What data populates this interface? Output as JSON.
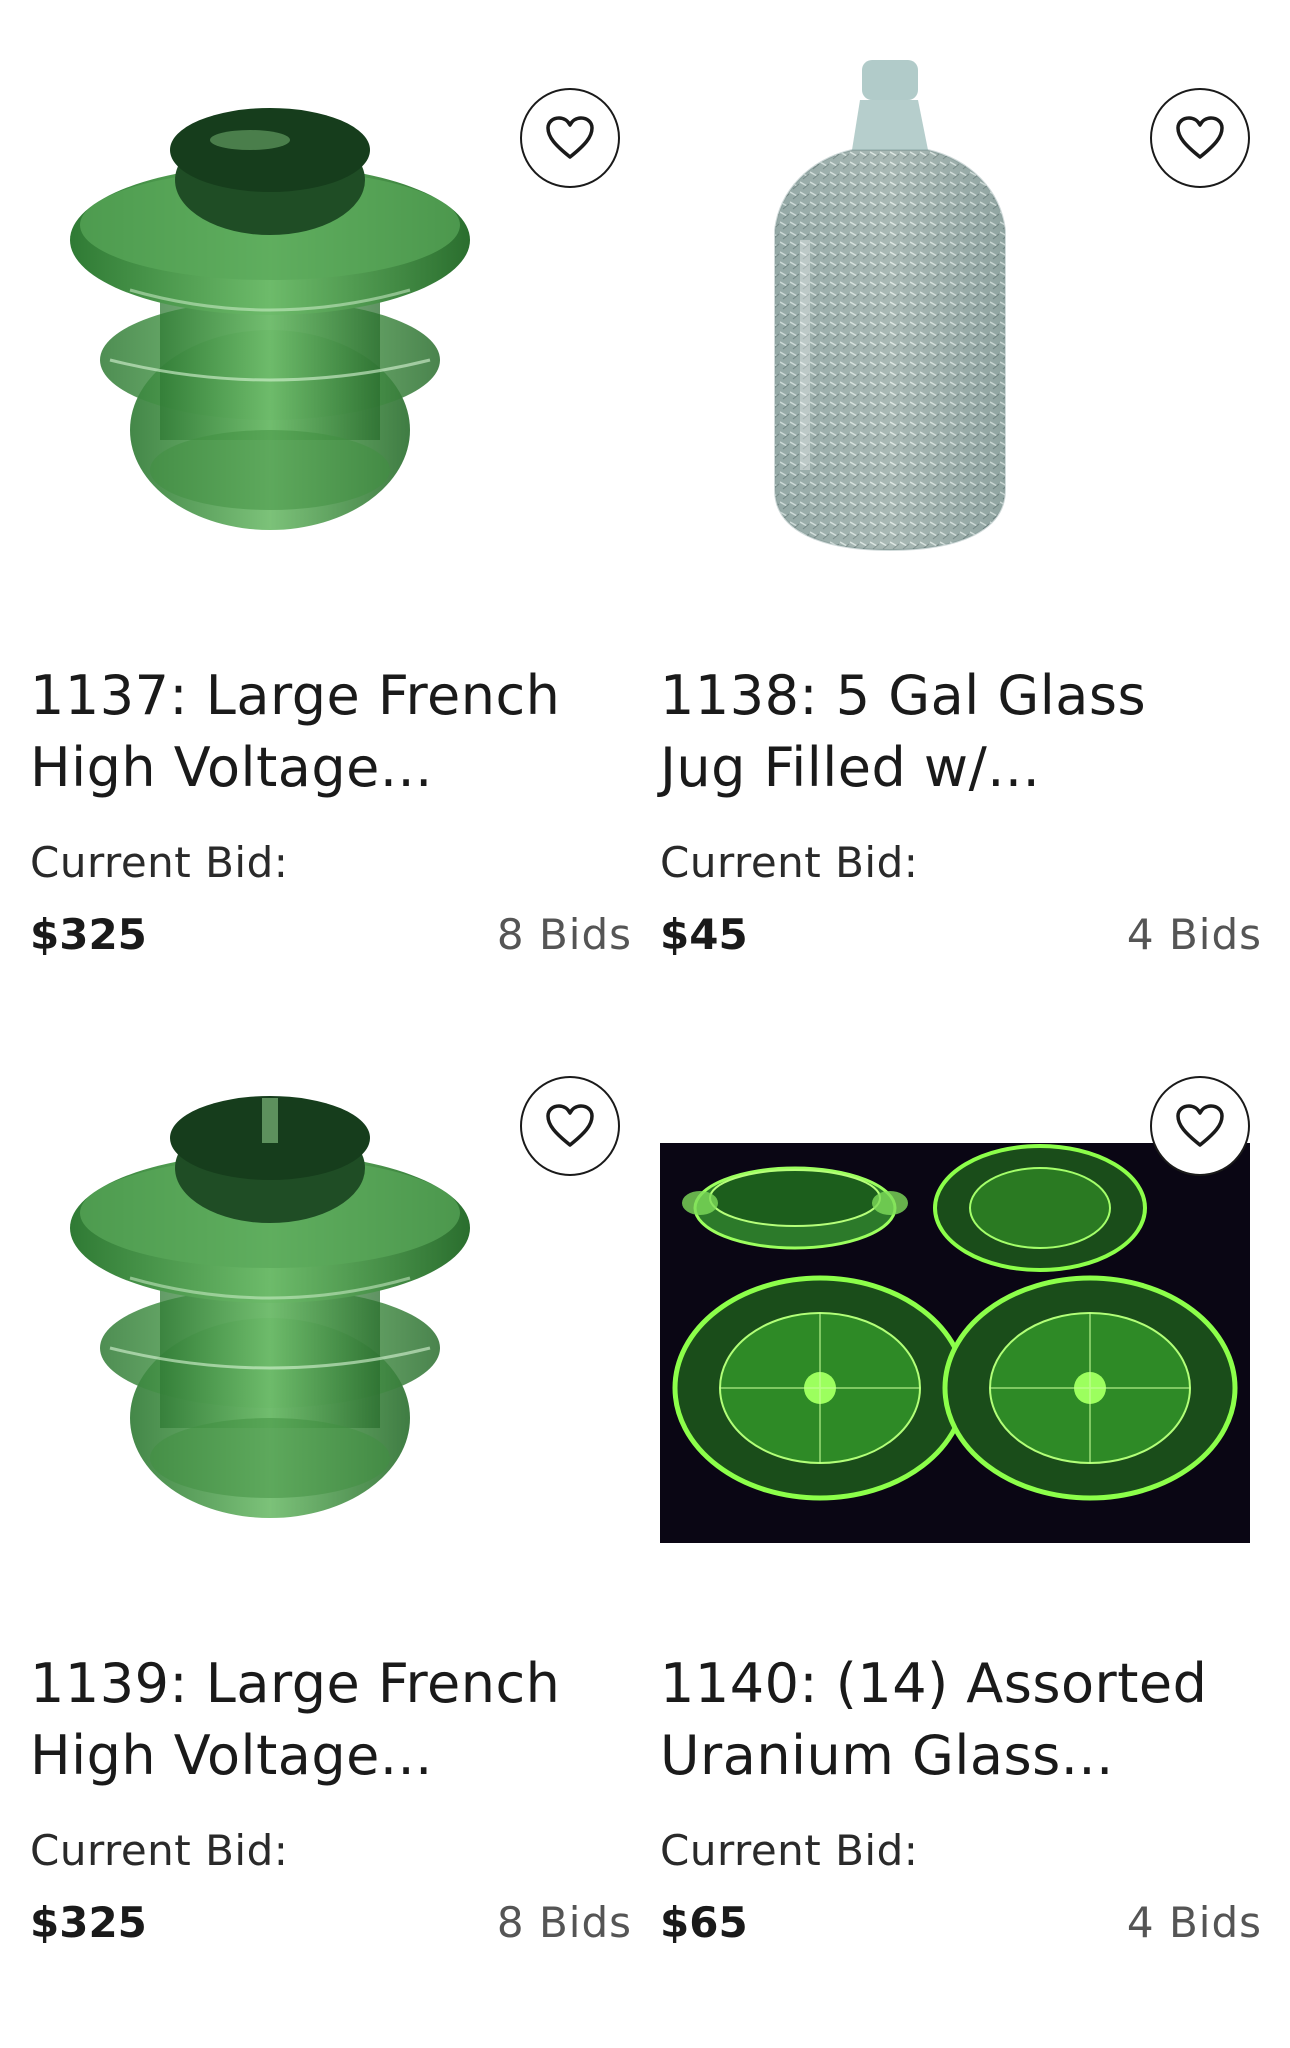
{
  "lots": [
    {
      "title": "1137: Large French\nHigh Voltage...",
      "bid_label": "Current Bid:",
      "price": "$325",
      "bids": "8 Bids",
      "image": "green-glass-insulator"
    },
    {
      "title": "1138: 5 Gal Glass\nJug Filled w/...",
      "bid_label": "Current Bid:",
      "price": "$45",
      "bids": "4 Bids",
      "image": "glass-jug-filled"
    },
    {
      "title": "1139: Large French\nHigh Voltage...",
      "bid_label": "Current Bid:",
      "price": "$325",
      "bids": "8 Bids",
      "image": "green-glass-insulator"
    },
    {
      "title": "1140: (14) Assorted\nUranium Glass...",
      "bid_label": "Current Bid:",
      "price": "$65",
      "bids": "4 Bids",
      "image": "uranium-glass-plates"
    }
  ],
  "icons": {
    "favorite": "heart-outline-icon"
  },
  "colors": {
    "text": "#1a1a1a",
    "muted": "#555555",
    "glass_green": "#3f8f3f",
    "uranium_green": "#8cff4a",
    "photo_dark_bg": "#0a0614"
  }
}
